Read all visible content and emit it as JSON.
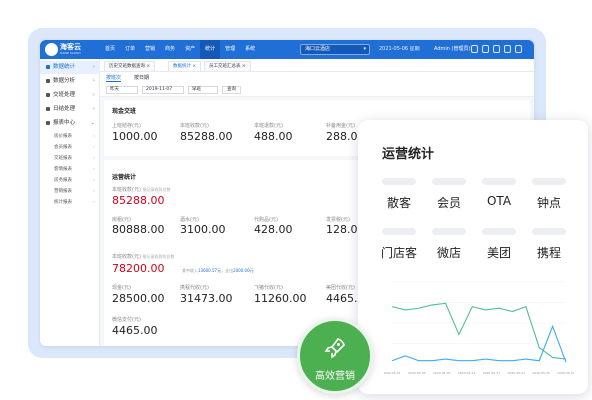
{
  "app": {
    "brand": "海客云",
    "brand_sub": "HAIKE CLOUD",
    "nav": [
      "首页",
      "订单",
      "营销",
      "商务",
      "资产",
      "统计",
      "管理",
      "系统"
    ],
    "nav_active": "统计",
    "store_select": "海口云酒店",
    "date": "2021-05-06",
    "weekday": "星期",
    "user": "Admin (管理员)"
  },
  "sidebar": {
    "items": [
      {
        "label": "数据统计",
        "active": true
      },
      {
        "label": "数据分析",
        "active": false
      },
      {
        "label": "交班处理",
        "active": false
      },
      {
        "label": "日结处理",
        "active": false
      },
      {
        "label": "报表中心",
        "active": false
      }
    ],
    "subitems": [
      "房价报表",
      "会员报表",
      "交班报表",
      "客情报表",
      "房务报表",
      "营销报表",
      "统计报表"
    ]
  },
  "tabs": [
    "历史交班数据查询",
    "数据统计",
    "员工交班汇总表"
  ],
  "subtabs": [
    "按班次",
    "按日期"
  ],
  "filters": {
    "range": "昨天",
    "date": "2019-11-07",
    "shift": "早班",
    "query_btn": "查询"
  },
  "cash": {
    "title": "现金交班",
    "detail_link": "详情",
    "metrics": [
      {
        "label": "上班结存(元)",
        "value": "1000.00"
      },
      {
        "label": "本班收款(元)",
        "value": "85288.00"
      },
      {
        "label": "本班退款(元)",
        "value": "488.00"
      },
      {
        "label": "补备用金(元)",
        "value": "288.00"
      }
    ]
  },
  "ops": {
    "title": "运营统计",
    "income_label": "本班收款(元)",
    "income_note": "指记录收款总数",
    "income_value": "85288.00",
    "row1": [
      {
        "label": "房租(元)",
        "value": "80888.00"
      },
      {
        "label": "酒水(元)",
        "value": "3100.00"
      },
      {
        "label": "代购品(元)",
        "value": "428.00"
      },
      {
        "label": "发票税(元)",
        "value": "128.00"
      }
    ],
    "pay_label": "本班收款(元)",
    "pay_note": "指记录收款的总数",
    "pay_value": "78200.00",
    "pay_detail_prefix": "其中收入",
    "pay_detail_amount": "13600.57元",
    "pay_detail_mid": "，支出",
    "pay_detail_amount2": "2000.00元",
    "row2": [
      {
        "label": "现金(元)",
        "value": "28500.00"
      },
      {
        "label": "携程代收(元)",
        "value": "31473.00"
      },
      {
        "label": "飞猪代收(元)",
        "value": "11260.00"
      },
      {
        "label": "美团代收(元)",
        "value": "4465.00"
      }
    ],
    "row3": [
      {
        "label": "微信支付(元)",
        "value": "4465.00"
      }
    ]
  },
  "panel": {
    "title": "运营统计",
    "channels": [
      "散客",
      "会员",
      "OTA",
      "钟点",
      "门店客",
      "微店",
      "美团",
      "携程"
    ]
  },
  "badge": {
    "label": "高效营销"
  },
  "chart_data": {
    "type": "line",
    "x": [
      "2020-05-01",
      "2020-05-05",
      "2020-05-09",
      "2020-05-13",
      "2020-05-17",
      "2020-05-21",
      "2020-05-25",
      "2020-05-29",
      "2020-06-02",
      "2020-06-06",
      "2020-06-10",
      "2020-06-14",
      "2020-06-18",
      "2020-06-22"
    ],
    "xticks": [
      "2020-05-01",
      "2020-05-05",
      "2020-05-09",
      "2020-05-13",
      "2020-05-17",
      "2020-05-21",
      "2020-05-25",
      "2020-05-29"
    ],
    "series": [
      {
        "color": "#4fc08d",
        "values": [
          70,
          66,
          68,
          72,
          74,
          36,
          70,
          66,
          68,
          64,
          70,
          20,
          8,
          6
        ]
      },
      {
        "color": "#3fa9f5",
        "values": [
          4,
          10,
          4,
          4,
          6,
          4,
          4,
          6,
          4,
          4,
          6,
          4,
          46,
          2
        ]
      }
    ],
    "ylim": [
      0,
      100
    ],
    "grid": true
  }
}
